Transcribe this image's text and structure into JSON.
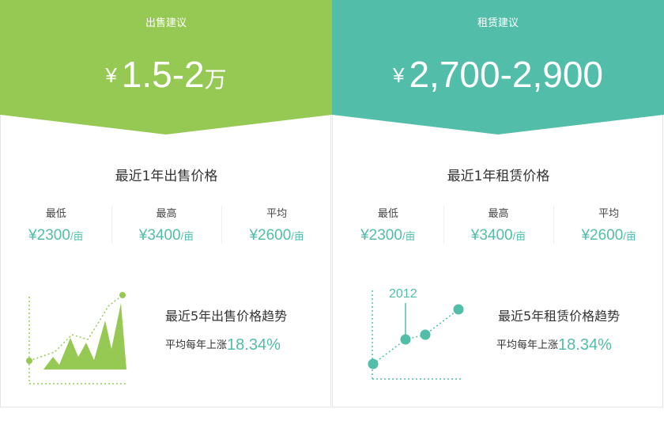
{
  "sale": {
    "label": "出售建议",
    "currency": "¥",
    "price": "1.5-2",
    "unit": "万",
    "color": "#96c953",
    "section_title": "最近1年出售价格",
    "stats": [
      {
        "label": "最低",
        "value": "¥2300",
        "unit": "/亩"
      },
      {
        "label": "最高",
        "value": "¥3400",
        "unit": "/亩"
      },
      {
        "label": "平均",
        "value": "¥2600",
        "unit": "/亩"
      }
    ],
    "trend_title": "最近5年出售价格趋势",
    "trend_sub_label": "平均每年上涨",
    "trend_pct": "18.34%"
  },
  "rent": {
    "label": "租赁建议",
    "currency": "¥",
    "price": "2,700-2,900",
    "color": "#52bda9",
    "section_title": "最近1年租赁价格",
    "stats": [
      {
        "label": "最低",
        "value": "¥2300",
        "unit": "/亩"
      },
      {
        "label": "最高",
        "value": "¥3400",
        "unit": "/亩"
      },
      {
        "label": "平均",
        "value": "¥2600",
        "unit": "/亩"
      }
    ],
    "trend_title": "最近5年租赁价格趋势",
    "trend_sub_label": "平均每年上涨",
    "trend_pct": "18.34%",
    "chart_year_label": "2012"
  },
  "accent_color": "#52bda9"
}
